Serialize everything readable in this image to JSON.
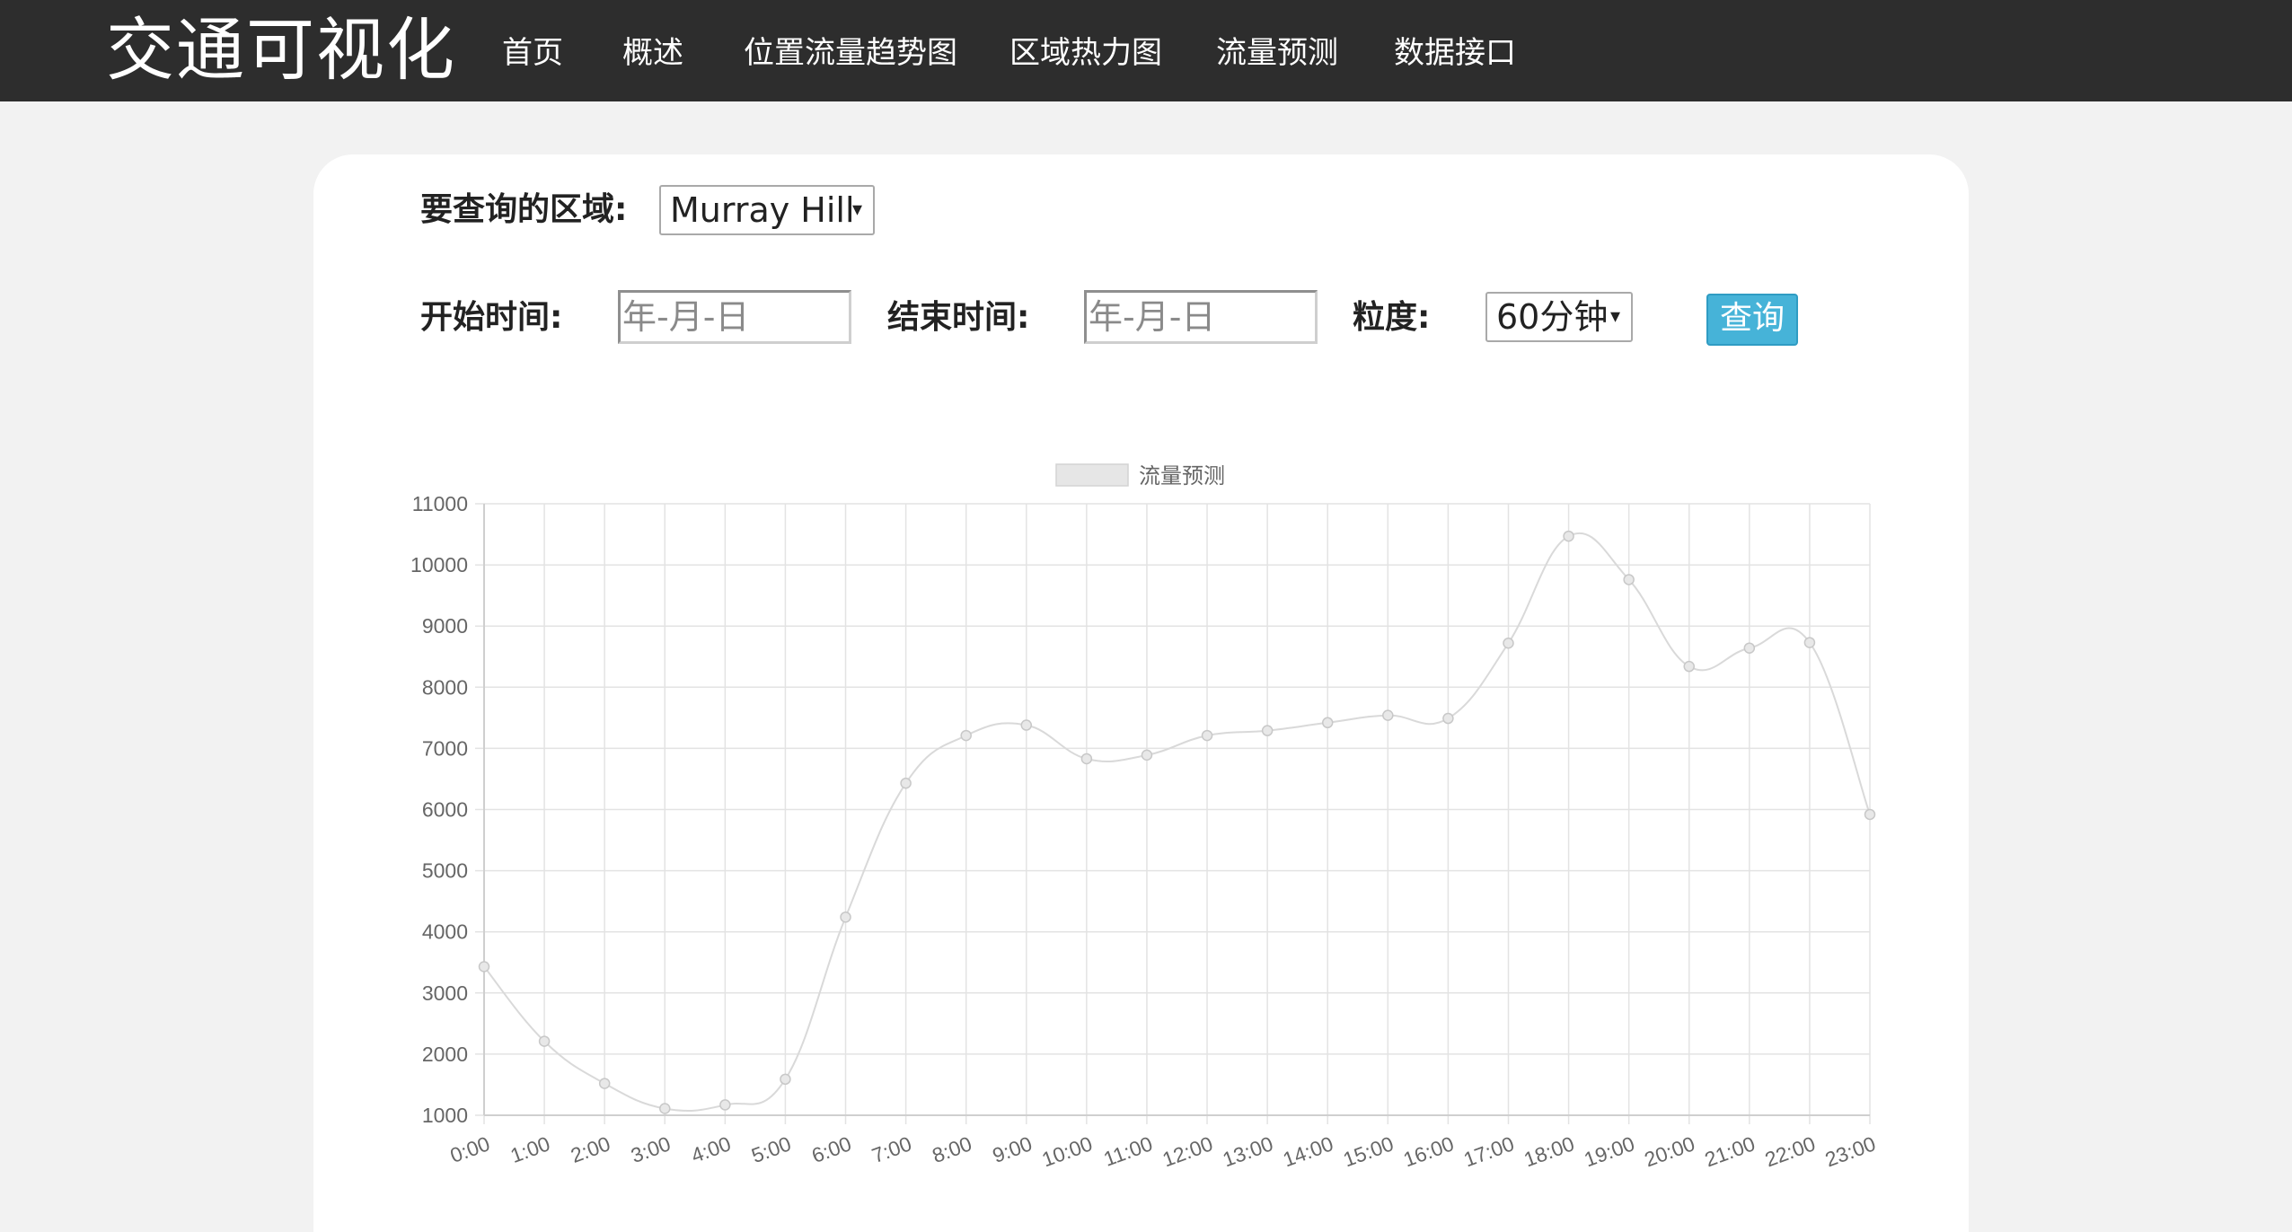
{
  "nav": {
    "brand": "交通可视化",
    "items": [
      {
        "id": "home",
        "label": "首页"
      },
      {
        "id": "overview",
        "label": "概述"
      },
      {
        "id": "location-flow-trend",
        "label": "位置流量趋势图"
      },
      {
        "id": "area-heatmap",
        "label": "区域热力图"
      },
      {
        "id": "flow-forecast",
        "label": "流量预测"
      },
      {
        "id": "data-api",
        "label": "数据接口"
      }
    ]
  },
  "form": {
    "area_label": "要查询的区域:",
    "area_value": "Murray Hill",
    "start_label": "开始时间:",
    "start_placeholder": "年-月-日",
    "end_label": "结束时间:",
    "end_placeholder": "年-月-日",
    "granularity_label": "粒度:",
    "granularity_value": "60分钟",
    "query_label": "查询",
    "dropdown_arrow": "▾"
  },
  "colors": {
    "navbar": "#2d2d2d",
    "query_button": "#46b3d8",
    "line": "#d9d9d9",
    "grid": "#e3e3e3"
  },
  "chart_data": {
    "type": "line",
    "legend": [
      "流量预测"
    ],
    "legend_position": "top-center",
    "grid": true,
    "categories": [
      "0:00",
      "1:00",
      "2:00",
      "3:00",
      "4:00",
      "5:00",
      "6:00",
      "7:00",
      "8:00",
      "9:00",
      "10:00",
      "11:00",
      "12:00",
      "13:00",
      "14:00",
      "15:00",
      "16:00",
      "17:00",
      "18:00",
      "19:00",
      "20:00",
      "21:00",
      "22:00",
      "23:00"
    ],
    "series": [
      {
        "name": "流量预测",
        "values": [
          3430,
          2210,
          1520,
          1110,
          1170,
          1590,
          4240,
          6430,
          7210,
          7380,
          6830,
          6890,
          7210,
          7290,
          7420,
          7540,
          7490,
          8720,
          10470,
          9760,
          8340,
          8640,
          8730,
          5920
        ]
      }
    ],
    "ylim": [
      1000,
      11000
    ],
    "yticks": [
      1000,
      2000,
      3000,
      4000,
      5000,
      6000,
      7000,
      8000,
      9000,
      10000,
      11000
    ]
  }
}
